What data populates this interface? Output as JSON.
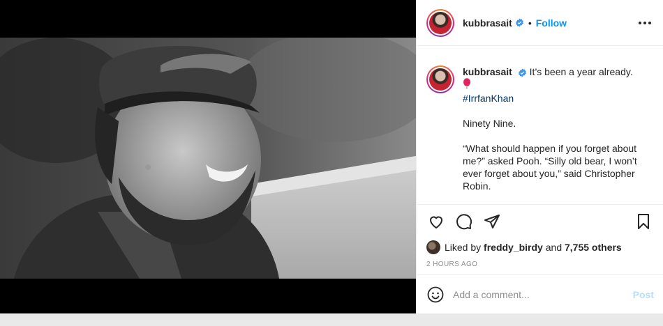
{
  "post": {
    "image_alt": "Black and white photo of a smiling man in a cap",
    "username": "kubbrasait",
    "verified_icon": "verified-badge-icon",
    "dot": "•",
    "follow_label": "Follow",
    "more_icon": "more-options-icon"
  },
  "caption": {
    "username": "kubbrasait",
    "line1": "It’s been a year already.",
    "emoji_icon": "balloon-icon",
    "hashtag": "#IrrfanKhan",
    "line2": "Ninety Nine.",
    "line3": "“What should happen if you forget about me?” asked Pooh. “Silly old bear, I won’t ever forget about you,” said Christopher Robin."
  },
  "actions": {
    "like_icon": "heart-icon",
    "comment_icon": "comment-icon",
    "share_icon": "share-icon",
    "save_icon": "bookmark-icon"
  },
  "likes": {
    "prefix": "Liked by",
    "liker": "freddy_birdy",
    "conj": "and",
    "others": "7,755 others"
  },
  "timestamp": "2 HOURS AGO",
  "comment_box": {
    "emoji_icon": "smiley-icon",
    "placeholder": "Add a comment...",
    "post_label": "Post"
  },
  "colors": {
    "link": "#0095f6",
    "hashtag": "#00376b",
    "muted": "#8e8e8e",
    "post_disabled": "#b2dffc"
  }
}
